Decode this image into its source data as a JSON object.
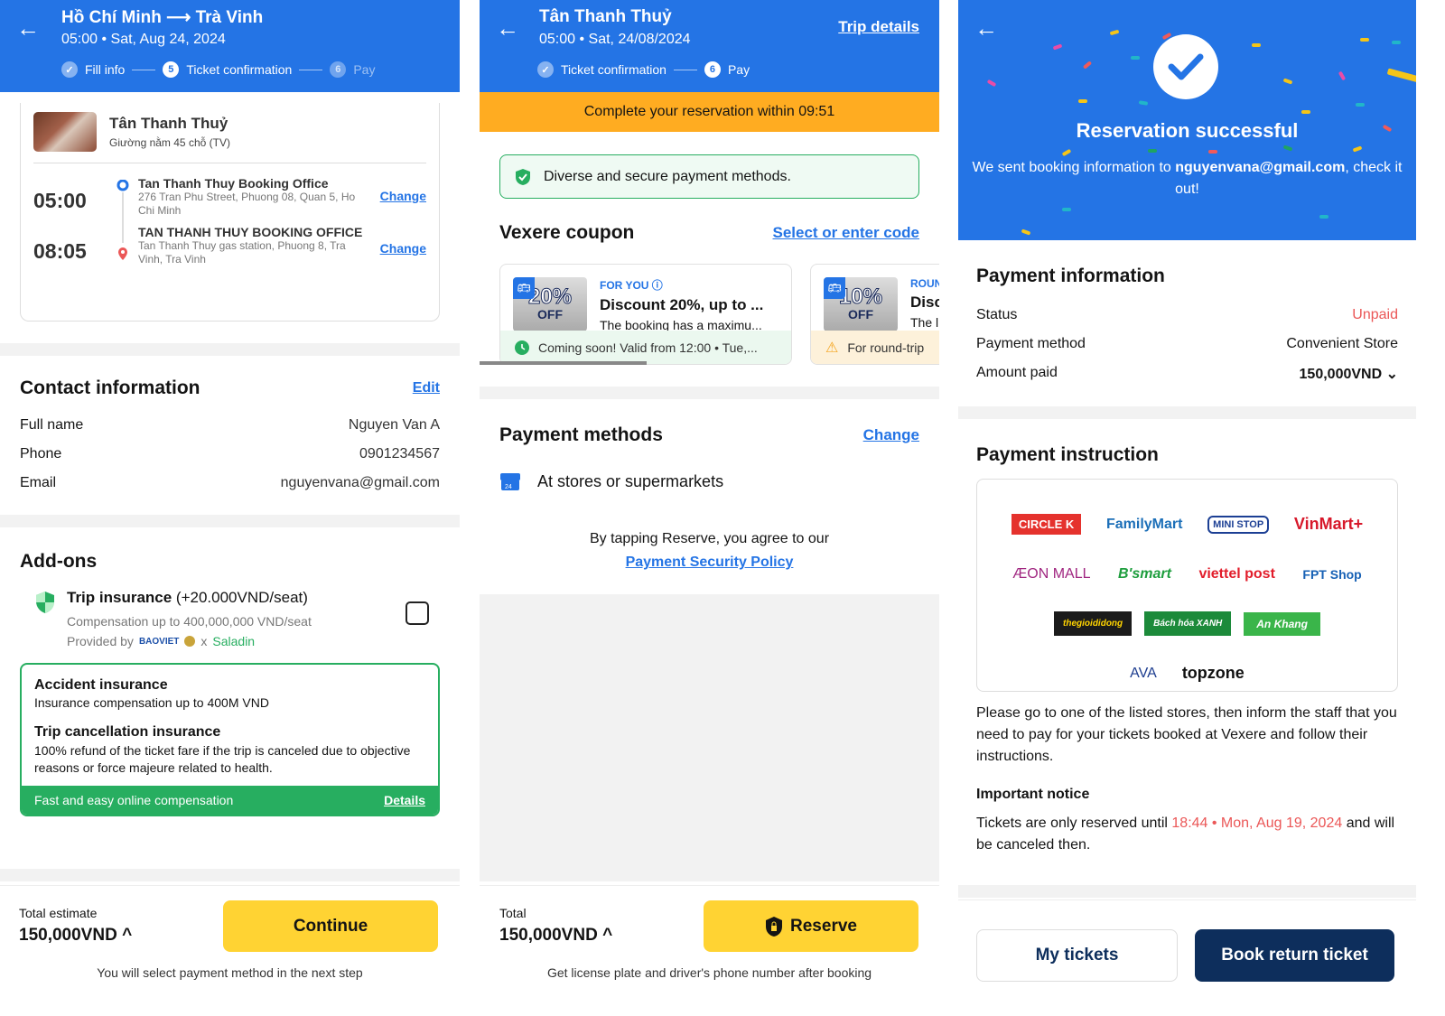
{
  "panel1": {
    "header": {
      "title": "Hồ Chí Minh ⟶ Trà Vinh",
      "subtitle": "05:00 • Sat, Aug 24, 2024",
      "steps": [
        {
          "num": "✓",
          "label": "Fill info"
        },
        {
          "num": "5",
          "label": "Ticket confirmation"
        },
        {
          "num": "6",
          "label": "Pay"
        }
      ]
    },
    "trip": {
      "operator": "Tân Thanh Thuỷ",
      "vehicle": "Giường nằm 45 chỗ (TV)",
      "pickup": {
        "time": "05:00",
        "name": "Tan Thanh Thuy Booking Office",
        "address": "276 Tran Phu Street, Phuong 08, Quan 5, Ho Chi Minh",
        "action": "Change"
      },
      "dropoff": {
        "time": "08:05",
        "name": "TAN THANH THUY BOOKING OFFICE",
        "address": "Tan Thanh Thuy gas station, Phuong 8, Tra Vinh, Tra Vinh",
        "action": "Change"
      }
    },
    "contact": {
      "title": "Contact information",
      "edit": "Edit",
      "rows": [
        {
          "label": "Full name",
          "value": "Nguyen Van A"
        },
        {
          "label": "Phone",
          "value": "0901234567"
        },
        {
          "label": "Email",
          "value": "nguyenvana@gmail.com"
        }
      ]
    },
    "addons": {
      "title": "Add-ons",
      "insurance_name": "Trip insurance",
      "insurance_price": " (+20.000VND/seat)",
      "compensation": "Compensation up to 400,000,000 VND/seat",
      "provided_by": "Provided by",
      "provider1": "BAOVIET",
      "provider_sep": "x",
      "provider2": "Saladin",
      "checked": false,
      "box": {
        "accident_title": "Accident insurance",
        "accident_desc": "Insurance compensation up to 400M VND",
        "cancel_title": "Trip cancellation insurance",
        "cancel_desc": "100% refund of the ticket fare if the trip is canceled due to objective reasons or force majeure related to health.",
        "footer": "Fast and easy online compensation",
        "details": "Details"
      }
    },
    "footer": {
      "total_label": "Total estimate",
      "total": "150,000VND ^",
      "button": "Continue",
      "note": "You will select payment method in the next step"
    }
  },
  "panel2": {
    "header": {
      "title": "Tân Thanh Thuỷ",
      "subtitle": "05:00 • Sat, 24/08/2024",
      "link": "Trip details",
      "steps": [
        {
          "num": "✓",
          "label": "Ticket confirmation"
        },
        {
          "num": "6",
          "label": "Pay"
        }
      ]
    },
    "timer": "Complete your reservation within 09:51",
    "secure": "Diverse and secure payment methods.",
    "coupon": {
      "title": "Vexere coupon",
      "link": "Select or enter code",
      "items": [
        {
          "pct": "20%",
          "off": "OFF",
          "tag": "FOR YOU",
          "title": "Discount 20%, up to ...",
          "desc": "The booking has a maximu...",
          "footer": "Coming soon! Valid from 12:00 • Tue,..."
        },
        {
          "pct": "10%",
          "off": "OFF",
          "tag": "ROUN",
          "title": "Disc",
          "desc": "The l",
          "footer": "For round-trip"
        }
      ]
    },
    "payment": {
      "title": "Payment methods",
      "change": "Change",
      "method": "At stores or supermarkets"
    },
    "agree": "By tapping Reserve, you agree to our",
    "policy": "Payment Security Policy",
    "footer": {
      "total_label": "Total",
      "total": "150,000VND ^",
      "button": "Reserve",
      "note": "Get license plate and driver's phone number after booking"
    }
  },
  "panel3": {
    "title": "Reservation successful",
    "desc_pre": "We sent booking information to ",
    "email": "nguyenvana@gmail.com",
    "desc_post": ", check it out!",
    "payinfo": {
      "title": "Payment information",
      "rows": [
        {
          "label": "Status",
          "value": "Unpaid"
        },
        {
          "label": "Payment method",
          "value": "Convenient Store"
        },
        {
          "label": "Amount paid",
          "value": "150,000VND ⌄"
        }
      ]
    },
    "instruction": {
      "title": "Payment instruction",
      "stores": [
        [
          "CIRCLE K",
          "FamilyMart",
          "MINI STOP",
          "VinMart+"
        ],
        [
          "ÆON MALL",
          "B'smart",
          "viettel post",
          "FPT Shop"
        ],
        [
          "thegioididong",
          "Bách hóa XANH",
          "An Khang"
        ],
        [
          "AVA",
          "topzone"
        ]
      ],
      "text": "Please go to one of the listed stores, then inform the staff that you need to pay for your tickets booked at Vexere and follow their instructions.",
      "notice_title": "Important notice",
      "notice_pre": "Tickets are only reserved until ",
      "notice_time": "18:44 • Mon, Aug 19, 2024",
      "notice_post": " and will be canceled then."
    },
    "buttons": {
      "my_tickets": "My tickets",
      "book_return": "Book return ticket"
    }
  }
}
